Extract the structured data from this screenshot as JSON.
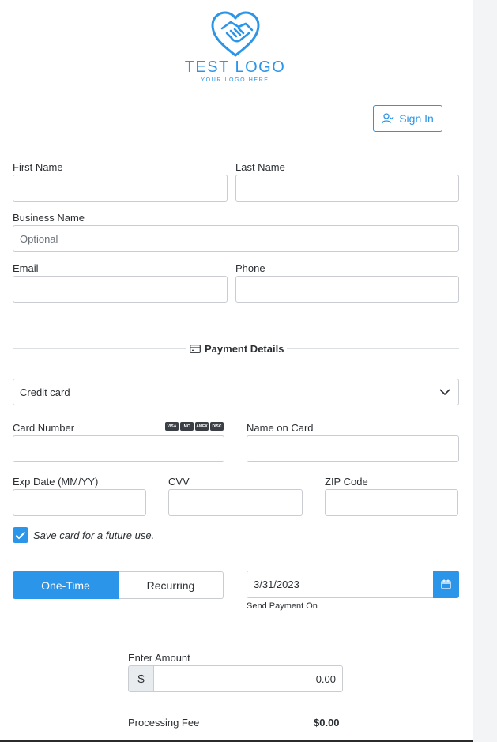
{
  "logo": {
    "title": "TEST LOGO",
    "subtitle": "YOUR LOGO HERE"
  },
  "header": {
    "sign_in_label": "Sign In"
  },
  "form": {
    "first_name": {
      "label": "First Name",
      "value": ""
    },
    "last_name": {
      "label": "Last Name",
      "value": ""
    },
    "business_name": {
      "label": "Business Name",
      "placeholder": "Optional"
    },
    "email": {
      "label": "Email",
      "value": ""
    },
    "phone": {
      "label": "Phone",
      "value": ""
    }
  },
  "payment": {
    "section_title": "Payment Details",
    "method_selected": "Credit card",
    "card_number_label": "Card Number",
    "card_brands": [
      "VISA",
      "MC",
      "AMEX",
      "DISC"
    ],
    "name_on_card_label": "Name on Card",
    "exp_label": "Exp Date (MM/YY)",
    "cvv_label": "CVV",
    "zip_label": "ZIP Code",
    "save_card_label": "Save card for a future use.",
    "save_card_checked": true
  },
  "schedule": {
    "one_time_label": "One-Time",
    "recurring_label": "Recurring",
    "date_value": "3/31/2023",
    "date_caption": "Send Payment On"
  },
  "amount": {
    "label": "Enter Amount",
    "currency_symbol": "$",
    "value": "0.00",
    "fee_label": "Processing Fee",
    "fee_value": "$0.00"
  },
  "colors": {
    "accent": "#2b95e9",
    "border": "#c9cdd2",
    "text": "#2b2f33"
  }
}
